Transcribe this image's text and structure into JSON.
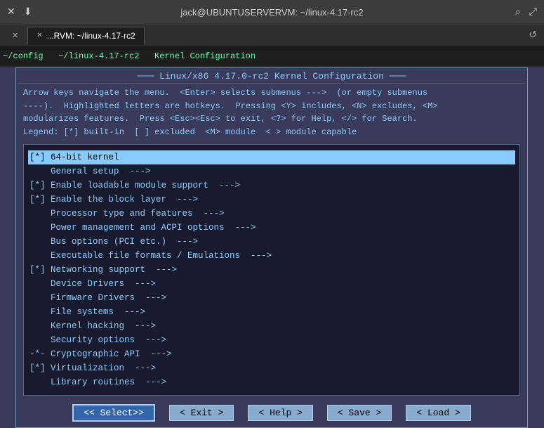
{
  "titlebar": {
    "title": "jack@UBUNTUSERVERVM: ~/linux-4.17-rc2",
    "left_icons": [
      "✕",
      "⬇"
    ],
    "right_icons": [
      "🔍",
      "⤢"
    ],
    "history_icon": "↺"
  },
  "tabs": [
    {
      "id": "tab1",
      "label": "✕",
      "active": false
    },
    {
      "id": "tab2",
      "label": "...RVM: ~/linux-4.17-rc2",
      "active": true,
      "close": "✕"
    }
  ],
  "terminal": {
    "prompt": "~/config  ~/linux-4.17-rc2  Kernel Configuration"
  },
  "kernel_config": {
    "title": "Linux/x86 4.17.0-rc2 Kernel Configuration",
    "help_text": [
      "Arrow keys navigate the menu.  <Enter> selects submenus --->  (or empty submenus",
      "----).  Highlighted letters are hotkeys.  Pressing <Y> includes, <N> excludes, <M>",
      "modularizes features.  Press <Esc><Esc> to exit, <?> for Help, </> for Search.",
      "Legend: [*] built-in  [ ] excluded  <M> module  < > module capable"
    ],
    "menu_items": [
      {
        "text": "[*] 64-bit kernel",
        "selected": true
      },
      {
        "text": "    General setup  --->"
      },
      {
        "text": "[*] Enable loadable module support  --->"
      },
      {
        "text": "[*] Enable the block layer  --->"
      },
      {
        "text": "    Processor type and features  --->"
      },
      {
        "text": "    Power management and ACPI options  --->"
      },
      {
        "text": "    Bus options (PCI etc.)  --->"
      },
      {
        "text": "    Executable file formats / Emulations  --->"
      },
      {
        "text": "[*] Networking support  --->"
      },
      {
        "text": "    Device Drivers  --->"
      },
      {
        "text": "    Firmware Drivers  --->"
      },
      {
        "text": "    File systems  --->"
      },
      {
        "text": "    Kernel hacking  --->"
      },
      {
        "text": "    Security options  --->"
      },
      {
        "text": "-*- Cryptographic API  --->"
      },
      {
        "text": "[*] Virtualization  --->"
      },
      {
        "text": "    Library routines  --->"
      }
    ],
    "buttons": [
      {
        "id": "select",
        "label": "< Select>",
        "primary": true
      },
      {
        "id": "exit",
        "label": "< Exit >"
      },
      {
        "id": "help",
        "label": "< Help >"
      },
      {
        "id": "save",
        "label": "< Save >"
      },
      {
        "id": "load",
        "label": "< Load >"
      }
    ]
  }
}
